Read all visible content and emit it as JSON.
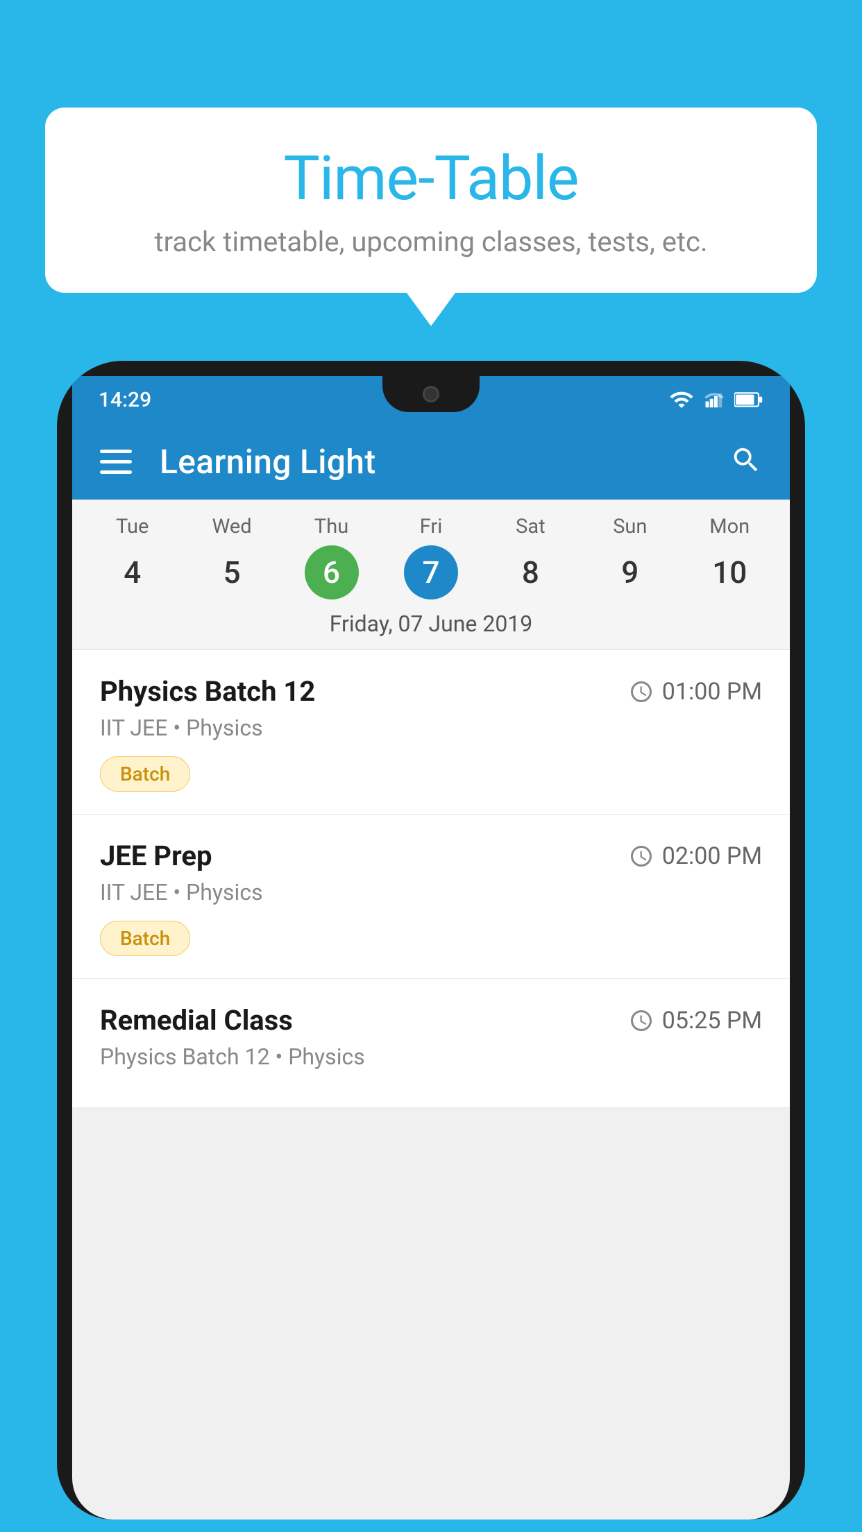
{
  "background_color": "#29B6E8",
  "tooltip": {
    "title": "Time-Table",
    "subtitle": "track timetable, upcoming classes, tests, etc."
  },
  "phone": {
    "status_bar": {
      "time": "14:29"
    },
    "app_name": "Learning Light",
    "calendar": {
      "days": [
        {
          "name": "Tue",
          "num": "4",
          "state": "normal"
        },
        {
          "name": "Wed",
          "num": "5",
          "state": "normal"
        },
        {
          "name": "Thu",
          "num": "6",
          "state": "today"
        },
        {
          "name": "Fri",
          "num": "7",
          "state": "selected"
        },
        {
          "name": "Sat",
          "num": "8",
          "state": "normal"
        },
        {
          "name": "Sun",
          "num": "9",
          "state": "normal"
        },
        {
          "name": "Mon",
          "num": "10",
          "state": "normal"
        }
      ],
      "selected_date_label": "Friday, 07 June 2019"
    },
    "classes": [
      {
        "name": "Physics Batch 12",
        "time": "01:00 PM",
        "meta": "IIT JEE • Physics",
        "badge": "Batch"
      },
      {
        "name": "JEE Prep",
        "time": "02:00 PM",
        "meta": "IIT JEE • Physics",
        "badge": "Batch"
      },
      {
        "name": "Remedial Class",
        "time": "05:25 PM",
        "meta": "Physics Batch 12 • Physics",
        "badge": ""
      }
    ]
  }
}
